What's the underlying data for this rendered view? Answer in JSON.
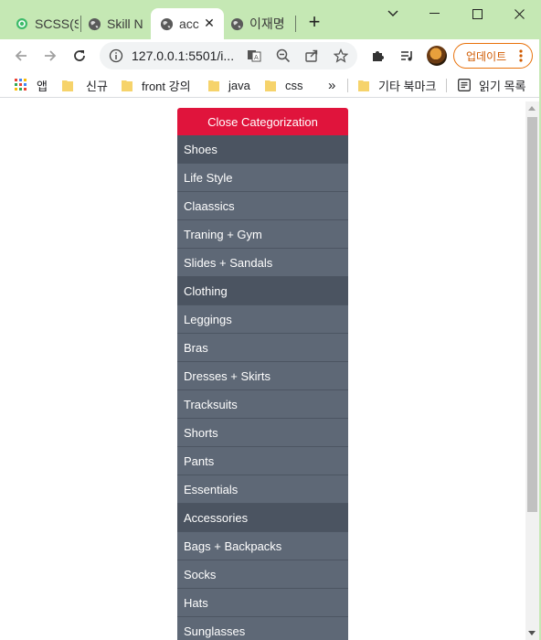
{
  "browser": {
    "tabs": [
      {
        "title": "SCSS(S",
        "favicon": "scss-icon",
        "active": false
      },
      {
        "title": "Skill Nc",
        "favicon": "globe-icon",
        "active": false
      },
      {
        "title": "acc",
        "favicon": "globe-icon",
        "active": true
      },
      {
        "title": "이재명",
        "favicon": "globe-icon",
        "active": false
      }
    ],
    "new_tab_label": "+",
    "url": "127.0.0.1:5501/i...",
    "update_label": "업데이트",
    "bookmarks": [
      {
        "label": "앱",
        "icon": "apps-grid-icon"
      },
      {
        "label": "신규",
        "icon": "folder-icon"
      },
      {
        "label": "front 강의",
        "icon": "folder-icon"
      },
      {
        "label": "java",
        "icon": "folder-icon"
      },
      {
        "label": "css",
        "icon": "folder-icon"
      }
    ],
    "overflow_label": "»",
    "other_bookmarks": "기타 북마크",
    "reading_list": "읽기 목록"
  },
  "menu": {
    "header": "Close Categorization",
    "items": [
      {
        "label": "Shoes",
        "type": "category"
      },
      {
        "label": "Life Style",
        "type": "item"
      },
      {
        "label": "Claassics",
        "type": "item"
      },
      {
        "label": "Traning + Gym",
        "type": "item"
      },
      {
        "label": "Slides + Sandals",
        "type": "item"
      },
      {
        "label": "Clothing",
        "type": "category"
      },
      {
        "label": "Leggings",
        "type": "item"
      },
      {
        "label": "Bras",
        "type": "item"
      },
      {
        "label": "Dresses + Skirts",
        "type": "item"
      },
      {
        "label": "Tracksuits",
        "type": "item"
      },
      {
        "label": "Shorts",
        "type": "item"
      },
      {
        "label": "Pants",
        "type": "item"
      },
      {
        "label": "Essentials",
        "type": "item"
      },
      {
        "label": "Accessories",
        "type": "category"
      },
      {
        "label": "Bags + Backpacks",
        "type": "item"
      },
      {
        "label": "Socks",
        "type": "item"
      },
      {
        "label": "Hats",
        "type": "item"
      },
      {
        "label": "Sunglasses",
        "type": "item"
      }
    ]
  },
  "colors": {
    "tabstrip": "#c5e8b4",
    "menu_header": "#e0143c",
    "menu_item": "#5e6876",
    "menu_category": "#4b5461",
    "update_accent": "#e8710a"
  }
}
